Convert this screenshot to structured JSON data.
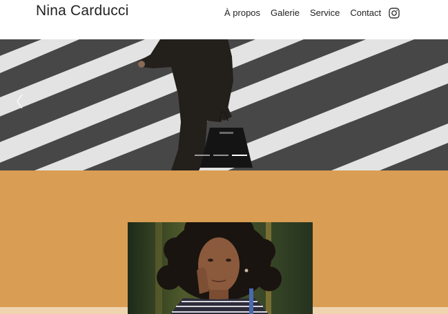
{
  "header": {
    "logo": "Nina Carducci",
    "nav": [
      {
        "label": "À propos"
      },
      {
        "label": "Galerie"
      },
      {
        "label": "Service"
      },
      {
        "label": "Contact"
      }
    ],
    "social_icon": "instagram-icon"
  },
  "hero": {
    "image": "crosswalk-businessman-photo",
    "prev_icon": "chevron-left-icon",
    "slides_count": 3,
    "active_slide": 3
  },
  "about": {
    "background_color": "#d99d54",
    "image": "portrait-woman-curly-hair-photo"
  },
  "colors": {
    "accent": "#d99d54",
    "band": "#eed5b0",
    "text": "#222222"
  }
}
